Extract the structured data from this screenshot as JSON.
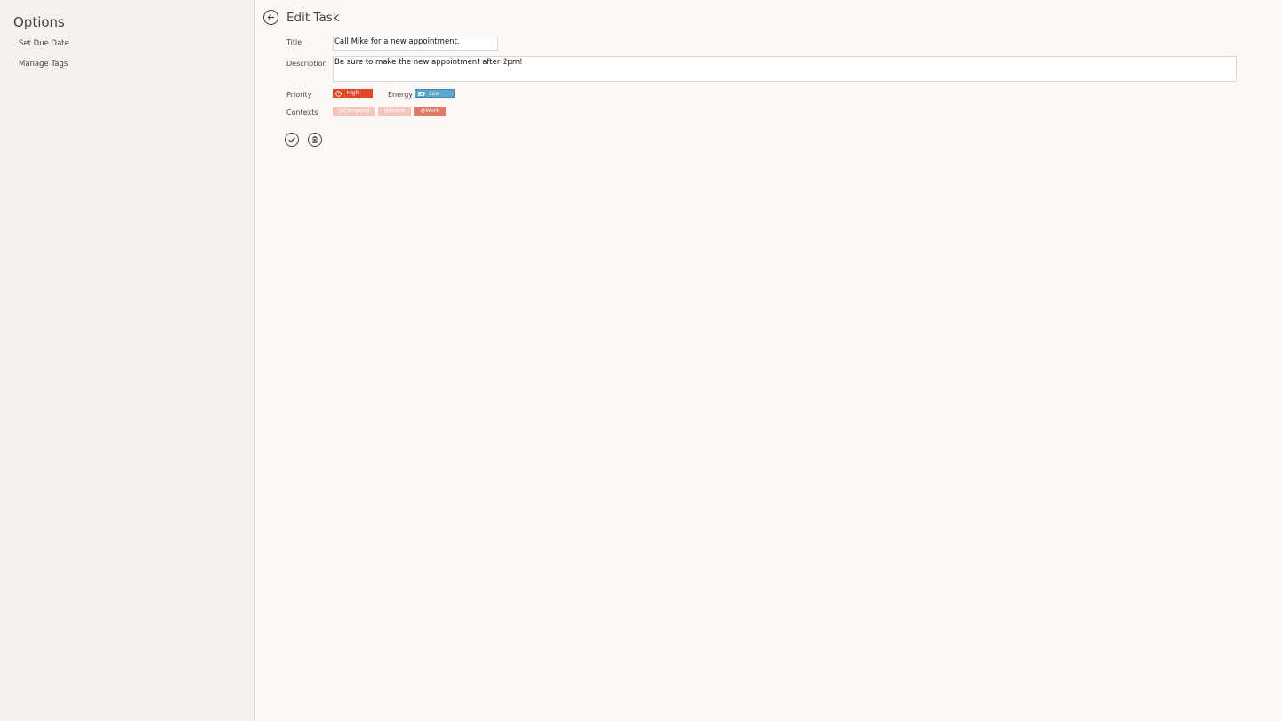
{
  "sidebar": {
    "title": "Options",
    "items": [
      {
        "label": "Set Due Date"
      },
      {
        "label": "Manage Tags"
      }
    ]
  },
  "header": {
    "title": "Edit Task"
  },
  "form": {
    "title_label": "Title",
    "title_value": "Call Mike for a new appointment.",
    "description_label": "Description",
    "description_value": "Be sure to make the new appointment after 2pm!",
    "priority_label": "Priority",
    "priority_value": "High",
    "energy_label": "Energy",
    "energy_value": "Low",
    "contexts_label": "Contexts",
    "contexts": [
      {
        "label": "@Computer",
        "selected": false
      },
      {
        "label": "@Home",
        "selected": false
      },
      {
        "label": "@Work",
        "selected": true
      }
    ]
  },
  "colors": {
    "priority_high": "#e2472a",
    "energy_low": "#5aa6cc",
    "context_unselected": "#f5c6bd",
    "context_selected": "#e07862",
    "background": "#fcf8f6",
    "sidebar_background": "#f5f2ee"
  },
  "icons": {
    "back": "arrow-left-circle-icon",
    "priority": "gauge-icon",
    "energy": "battery-icon",
    "save": "checkmark-icon",
    "delete": "trash-icon"
  }
}
